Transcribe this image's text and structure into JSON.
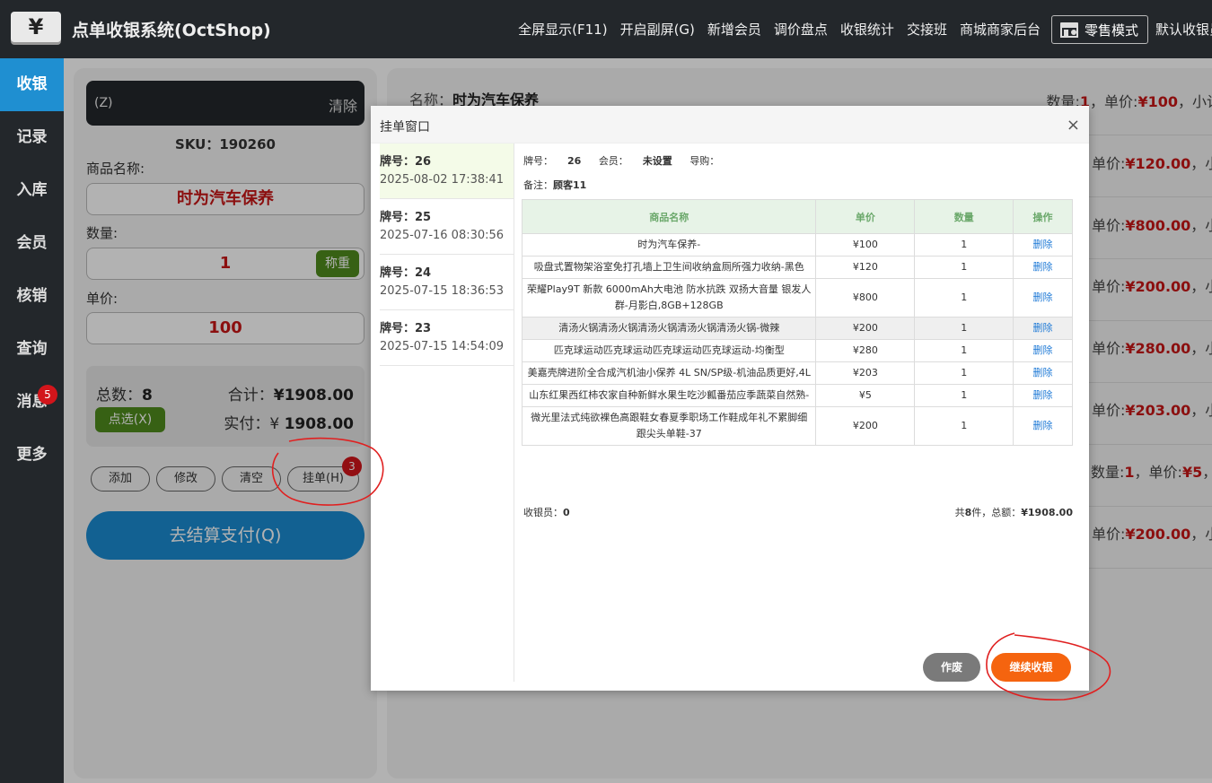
{
  "topbar": {
    "logo_glyph": "¥",
    "app_title": "点单收银系统(OctShop)",
    "nav": [
      "全屏显示(F11)",
      "开启副屏(G)",
      "新增会员",
      "调价盘点",
      "收银统计",
      "交接班",
      "商城商家后台"
    ],
    "retail_mode": "零售模式",
    "cashier_cut": "默认收银员"
  },
  "sidebar": {
    "items": [
      {
        "label": "收银",
        "active": true
      },
      {
        "label": "记录"
      },
      {
        "label": "入库"
      },
      {
        "label": "会员"
      },
      {
        "label": "核销"
      },
      {
        "label": "查询"
      },
      {
        "label": "消息",
        "badge": "5"
      },
      {
        "label": "更多"
      }
    ]
  },
  "left_panel": {
    "scan_placeholder": "(Z)",
    "scan_clear": "清除",
    "sku": "SKU：190260",
    "name_label": "商品名称:",
    "name_value": "时为汽车保养",
    "qty_label": "数量:",
    "qty_value": "1",
    "weigh_label": "称重",
    "price_label": "单价:",
    "price_value": "100",
    "count_label": "总数：",
    "count_value": "8",
    "total_label": "合计：",
    "total_value": "¥1908.00",
    "pick_label": "点选(X)",
    "paid_label": "实付：¥ ",
    "paid_value": "1908.00",
    "ops": {
      "add": "添加",
      "edit": "修改",
      "clear": "清空",
      "hold": "挂单(H)",
      "hold_badge": "3"
    },
    "pay_label": "去结算支付(Q)"
  },
  "right_panel": {
    "rows": [
      {
        "name_label": "名称：",
        "name": "时为汽车保养",
        "price_text": "数量:",
        "qty": "1",
        "sep": "，单价:",
        "price": "¥100",
        "tail": "，小计"
      },
      {
        "price_text": "单价:",
        "price": "¥120.00",
        "tail": "，小计"
      },
      {
        "price_text": "单价:",
        "price": "¥800.00",
        "tail": "，小计"
      },
      {
        "price_text": "单价:",
        "price": "¥200.00",
        "tail": "，小计"
      },
      {
        "price_text": "单价:",
        "price": "¥280.00",
        "tail": "，小计"
      },
      {
        "price_text": "单价:",
        "price": "¥203.00",
        "tail": "，小计"
      },
      {
        "price_text": "数量:",
        "qty": "1",
        "sep": "，单价:",
        "price": "¥5",
        "tail": "，小"
      },
      {
        "price_text": "单价:",
        "price": "¥200.00",
        "tail": "，小计"
      }
    ]
  },
  "modal": {
    "title": "挂单窗口",
    "close": "×",
    "orders": [
      {
        "label": "牌号：",
        "no": "26",
        "time": "2025-08-02 17:38:41",
        "active": true
      },
      {
        "label": "牌号：",
        "no": "25",
        "time": "2025-07-16 08:30:56"
      },
      {
        "label": "牌号：",
        "no": "24",
        "time": "2025-07-15 18:36:53"
      },
      {
        "label": "牌号：",
        "no": "23",
        "time": "2025-07-15 14:54:09"
      }
    ],
    "info": {
      "no_label": "牌号：",
      "no": "26",
      "member_label": "会员：",
      "member": "未设置",
      "guide_label": "导购：",
      "guide": "",
      "note_label": "备注：",
      "note": "顾客11"
    },
    "columns": [
      "商品名称",
      "单价",
      "数量",
      "操作"
    ],
    "goods": [
      {
        "name": "时为汽车保养-",
        "price": "¥100",
        "qty": "1",
        "op": "删除"
      },
      {
        "name": "吸盘式置物架浴室免打孔墙上卫生间收纳盒厕所强力收纳-黑色",
        "price": "¥120",
        "qty": "1",
        "op": "删除"
      },
      {
        "name": "荣耀Play9T 新款 6000mAh大电池 防水抗跌 双扬大音量 银发人群-月影白,8GB+128GB",
        "price": "¥800",
        "qty": "1",
        "op": "删除"
      },
      {
        "name": "清汤火锅清汤火锅清汤火锅清汤火锅清汤火锅-微辣",
        "price": "¥200",
        "qty": "1",
        "op": "删除",
        "highlight": true
      },
      {
        "name": "匹克球运动匹克球运动匹克球运动匹克球运动-均衡型",
        "price": "¥280",
        "qty": "1",
        "op": "删除"
      },
      {
        "name": "美嘉壳牌进阶全合成汽机油小保养 4L SN/SP级-机油品质更好,4L",
        "price": "¥203",
        "qty": "1",
        "op": "删除"
      },
      {
        "name": "山东红果西红柿农家自种新鲜水果生吃沙瓤番茄应季蔬菜自然熟-",
        "price": "¥5",
        "qty": "1",
        "op": "删除"
      },
      {
        "name": "微光里法式纯欲裸色高跟鞋女春夏季职场工作鞋成年礼不累脚细跟尖头单鞋-37",
        "price": "¥200",
        "qty": "1",
        "op": "删除"
      }
    ],
    "cashier_label": "收银员：",
    "cashier": "0",
    "total_prefix": "共",
    "total_count": "8",
    "total_mid": "件，总额：",
    "total_amount": "¥1908.00",
    "void_label": "作废",
    "continue_label": "继续收银"
  }
}
